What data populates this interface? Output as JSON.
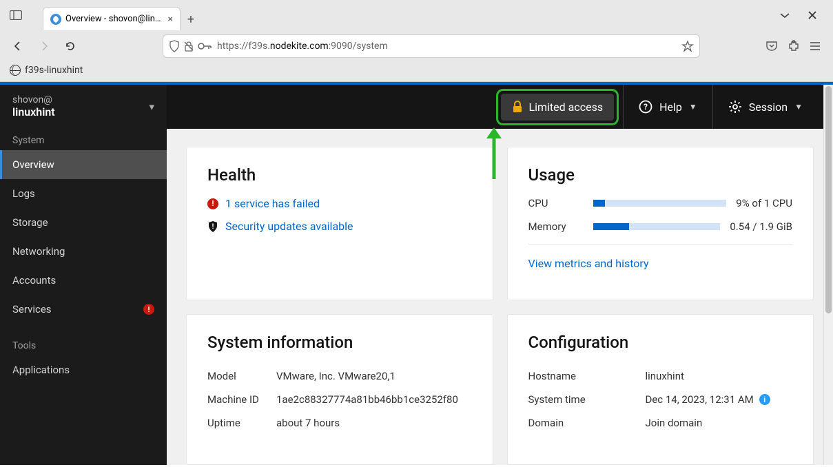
{
  "browser": {
    "tab_title": "Overview - shovon@linux",
    "bookmark": "f39s-linuxhint",
    "url_prefix": "https://f39s.",
    "url_host": "nodekite.com",
    "url_suffix": ":9090/system"
  },
  "sidebar": {
    "user": "shovon@",
    "host": "linuxhint",
    "section_system": "System",
    "section_tools": "Tools",
    "items": {
      "overview": "Overview",
      "logs": "Logs",
      "storage": "Storage",
      "networking": "Networking",
      "accounts": "Accounts",
      "services": "Services",
      "applications": "Applications"
    }
  },
  "topbar": {
    "limited": "Limited access",
    "help": "Help",
    "session": "Session"
  },
  "health": {
    "title": "Health",
    "failed": "1 service has failed",
    "security": "Security updates available"
  },
  "usage": {
    "title": "Usage",
    "cpu_label": "CPU",
    "cpu_pct": 9,
    "cpu_text": "9% of 1 CPU",
    "mem_label": "Memory",
    "mem_used": 0.54,
    "mem_total": 1.9,
    "mem_text": "0.54 / 1.9 GiB",
    "metrics_link": "View metrics and history"
  },
  "sysinfo": {
    "title": "System information",
    "model_label": "Model",
    "model_val": "VMware, Inc. VMware20,1",
    "mid_label": "Machine ID",
    "mid_val": "1ae2c88327774a81bb46bb1ce3252f80",
    "uptime_label": "Uptime",
    "uptime_val": "about 7 hours"
  },
  "config": {
    "title": "Configuration",
    "host_label": "Hostname",
    "host_val": "linuxhint",
    "time_label": "System time",
    "time_val": "Dec 14, 2023, 12:31 AM",
    "domain_label": "Domain",
    "domain_val": "Join domain"
  }
}
